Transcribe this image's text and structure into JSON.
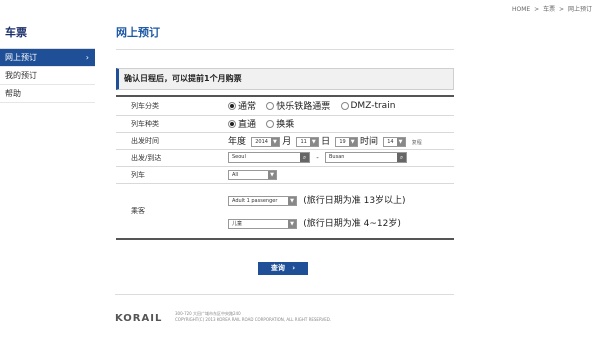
{
  "topbar": {
    "home": "HOME",
    "sep": ">",
    "crumb1": "车票",
    "crumb2": "网上预订"
  },
  "sidebar": {
    "title": "车票",
    "items": [
      {
        "label": "网上预订",
        "active": true
      },
      {
        "label": "我的预订",
        "active": false
      },
      {
        "label": "帮助",
        "active": false
      }
    ],
    "active_chevron": "›"
  },
  "page": {
    "title": "网上预订",
    "notice": "确认日程后，可以提前1个月购票"
  },
  "form": {
    "train_class": {
      "label": "列车分类",
      "options": [
        "通常",
        "快乐铁路通票",
        "DMZ-train"
      ],
      "selected": 0
    },
    "journey_type": {
      "label": "列车种类",
      "options": [
        "直通",
        "换乘"
      ],
      "selected": 0
    },
    "date": {
      "label": "出发时间",
      "year_label": "年度",
      "year": "2014",
      "month_label": "月",
      "month": "11",
      "day_label": "日",
      "day": "19",
      "time_label": "时间",
      "time": "14",
      "reset": "复程"
    },
    "route": {
      "label": "出发/到达",
      "from": "Seoul",
      "dash": "-",
      "to": "Busan"
    },
    "train": {
      "label": "列车",
      "value": "All"
    },
    "passengers": {
      "label": "乘客",
      "adult": {
        "value": "Adult 1 passenger",
        "hint": "(旅行日期为准 13岁以上)"
      },
      "child": {
        "value": "儿童",
        "hint": "(旅行日期为准 4~12岁)"
      }
    }
  },
  "search_button": {
    "label": "查询",
    "arrow": "›"
  },
  "footer": {
    "logo": "KORAIL",
    "address": "300-720 大田广域市东区中央路240",
    "copyright": "COPYRIGHT(C) 2013 KOREA RAIL ROAD CORPORATION, ALL RIGHT RESERVED."
  },
  "icons": {
    "search": "search-icon",
    "dropdown": "dropdown-arrow-icon"
  }
}
